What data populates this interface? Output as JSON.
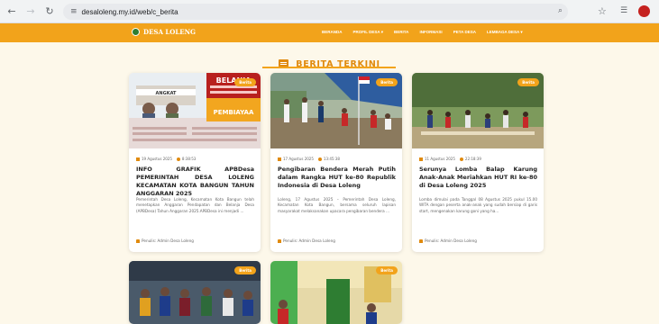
{
  "browser": {
    "url": "desaloleng.my.id/web/c_berita"
  },
  "nav": {
    "logo": "DESA LOLENG",
    "menu": [
      "BERANDA",
      "PROFIL DESA ▾",
      "BERITA",
      "INFORMASI",
      "PETA DESA",
      "LEMBAGA DESA ▾"
    ]
  },
  "section": {
    "title": "BERITA TERKINI"
  },
  "cards": [
    {
      "badge": "Berita",
      "date": "19 Agustus 2025",
      "time": "8:38:53",
      "title": "INFO GRAFIK APBDesa PEMERINTAH DESA LOLENG KECAMATAN KOTA BANGUN TAHUN ANGGARAN 2025",
      "excerpt": "Pemerintah Desa Loleng, Kecamatan Kota Bangun telah menetapkan Anggaran Pendapatan dan Belanja Desa (APBDesa) Tahun Anggaran 2025.APBDesa ini menjadi ...",
      "author": "Penulis: Admin Desa Loleng",
      "image_text": [
        "BELANJA",
        "PEMBIAYAA",
        "ANGKAT"
      ]
    },
    {
      "badge": "Berita",
      "date": "17 Agustus 2025",
      "time": "13:45:38",
      "title": "Pengibaran Bendera Merah Putih dalam Rangka HUT ke-80 Republik Indonesia di Desa Loleng",
      "excerpt": "Loleng, 17 Agustus 2025 – Pemerintah Desa Loleng, Kecamatan Kota Bangun, bersama seluruh lapisan masyarakat melaksanakan upacara pengibaran bendera ...",
      "author": "Penulis: Admin Desa Loleng"
    },
    {
      "badge": "Berita",
      "date": "11 Agustus 2025",
      "time": "22:18:39",
      "title": "Serunya Lomba Balap Karung Anak-Anak Meriahkan HUT RI ke-80 di Desa Loleng 2025",
      "excerpt": "Lomba dimulai pada Tanggal 08 Agustus 2025 pukul 15.00 WITA dengan peserta anak-anak yang sudah bersiap di garis start, mengenakan karung goni yang ha...",
      "author": "Penulis: Admin Desa Loleng"
    },
    {
      "badge": "Berita"
    },
    {
      "badge": "Berita"
    }
  ],
  "icons": {
    "back": "arrow-left-icon",
    "forward": "arrow-right-icon",
    "reload": "reload-icon",
    "news": "newspaper-icon"
  },
  "colors": {
    "accent": "#f2a31b",
    "heading": "#e08a0e",
    "background": "#fdf8ea"
  }
}
